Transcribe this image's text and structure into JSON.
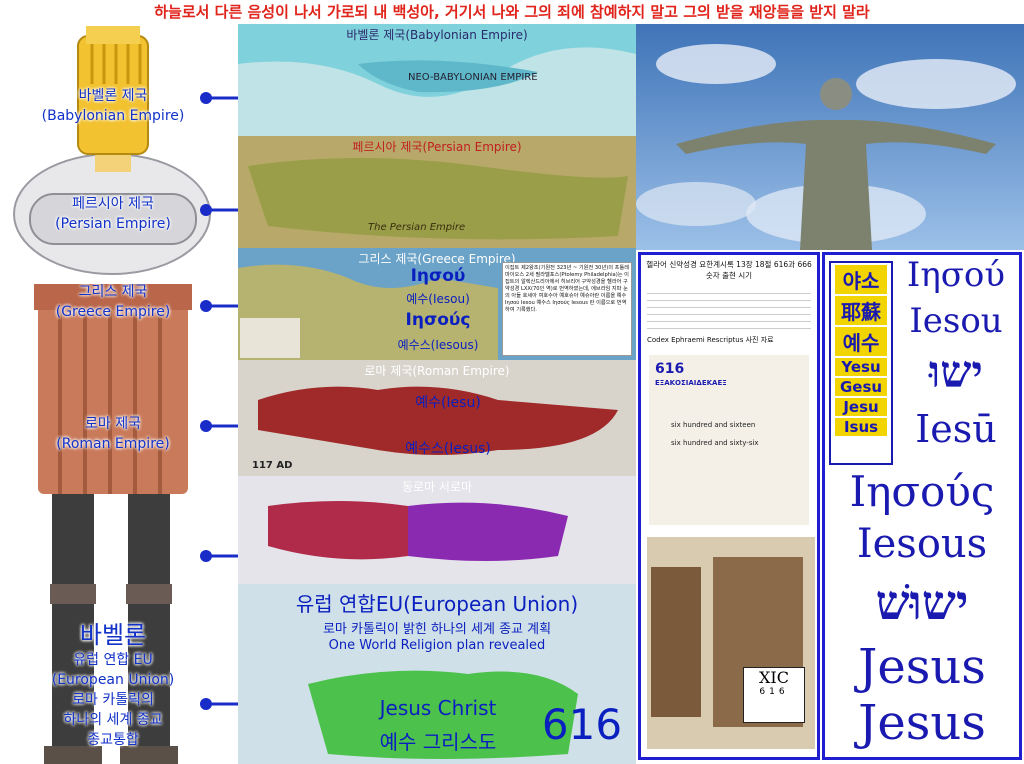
{
  "header": "하늘로서 다른 음성이 나서 가로되 내 백성아, 거기서 나와 그의 죄에 참예하지 말고 그의 받을 재앙들을 받지 말라",
  "left_labels": [
    {
      "ko": "바벨론 제국",
      "en": "(Babylonian Empire)"
    },
    {
      "ko": "페르시아 제국",
      "en": "(Persian Empire)"
    },
    {
      "ko": "그리스 제국",
      "en": "(Greece Empire)"
    },
    {
      "ko": "로마 제국",
      "en": "(Roman Empire)"
    }
  ],
  "bottom_left": {
    "big": "바벨론",
    "l1": "유럽 연합 EU",
    "l2": "(European Union)",
    "l3": "로마 카톨릭의",
    "l4": "하나의 세계 종교",
    "l5": "종교통합"
  },
  "maps": {
    "babylon_caption": "바벨론 제국(Babylonian Empire)",
    "babylon_center": "NEO-BABYLONIAN EMPIRE",
    "persia_caption": "페르시아 제국(Persian Empire)",
    "persia_small": "The Persian Empire",
    "greece_caption": "그리스 제국(Greece Empire)",
    "greece_t1": "Iησού",
    "greece_t2": "예수(Iesou)",
    "greece_t3": "Iησούς",
    "greece_t4": "예수스(Iesous)",
    "greece_note": "이집트 제2왕조(기원전 323년 ~ 기원전 30년)의 프톨레마이오스 2세 필라델포스(Ptolemy Philadelphia)는 이집트의 알렉산드리아에서 히브리어 구약성경을 헬라어 구약성경 LXX(70인 역)로 번역하였는데, 에브라임 지파 눈의 아들 호세아 여호수아 예호슈아 예슈아란 이름을 예수 Iησού Iesou 예수스 Iησούς Iesous 란 이름으로 번역하여 기록했다.",
    "rome_caption": "로마 제국(Roman Empire)",
    "rome_t1": "예수(Iesu)",
    "rome_t2": "예수스(Iesus)",
    "rome_year": "117 AD",
    "eastwest_caption": "동로마 서로마",
    "eu_title": "유럽 연합EU(European Union)",
    "eu_sub1": "로마 카톨릭이 밝힌 하나의 세계 종교 계획",
    "eu_sub2": "One World Religion plan revealed",
    "eu_jc": "Jesus Christ",
    "eu_jc_ko": "예수 그리스도",
    "eu_num": "616"
  },
  "doc": {
    "title": "헬라어 신약성경 요한계시록 13장 18절 616과 666숫자 출현 시기",
    "codex": "Codex Ephraemi Rescriptus 사진 자료",
    "num": "616",
    "greek": "ΕΞΑΚΟΣΙΑΙΔΕΚΑΕΞ",
    "six1": "six hundred and sixteen",
    "six2": "six hundred and sixty-six",
    "xic": "XIC",
    "xic_num": "616"
  },
  "names": {
    "ko1": "야소",
    "cn": "耶蘇",
    "ko2": "예수",
    "y1": "Yesu",
    "y2": "Gesu",
    "y3": "Jesu",
    "y4": "Isus",
    "n1": "Iησού",
    "n2": "Iesou",
    "n3": "ישוּ",
    "n4": "Iesū",
    "n5": "Iησούς",
    "n6": "Iesous",
    "n7": "ישוּשׁ",
    "n8": "Jesus",
    "n9": "Jesus"
  }
}
